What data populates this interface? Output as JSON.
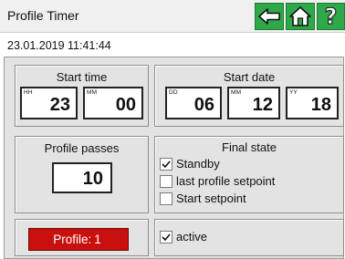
{
  "header": {
    "title": "Profile Timer",
    "back_icon": "back-arrow-icon",
    "home_icon": "home-icon",
    "help_label": "?"
  },
  "datetime": "23.01.2019 11:41:44",
  "start_time": {
    "title": "Start time",
    "hour_tag": "HH",
    "hour_value": "23",
    "minute_tag": "MM",
    "minute_value": "00"
  },
  "start_date": {
    "title": "Start date",
    "day_tag": "DD",
    "day_value": "06",
    "month_tag": "MM",
    "month_value": "12",
    "year_tag": "YY",
    "year_value": "18"
  },
  "profile_passes": {
    "title": "Profile passes",
    "value": "10"
  },
  "final_state": {
    "title": "Final state",
    "options": [
      {
        "label": "Standby",
        "checked": true
      },
      {
        "label": "last profile setpoint",
        "checked": false
      },
      {
        "label": "Start setpoint",
        "checked": false
      }
    ]
  },
  "profile_button": {
    "label": "Profile:",
    "number": "1"
  },
  "active_toggle": {
    "label": "active",
    "checked": true
  },
  "colors": {
    "accent_green": "#2fa84a",
    "profile_red": "#c8100e",
    "panel_gray": "#e3e3e3"
  }
}
